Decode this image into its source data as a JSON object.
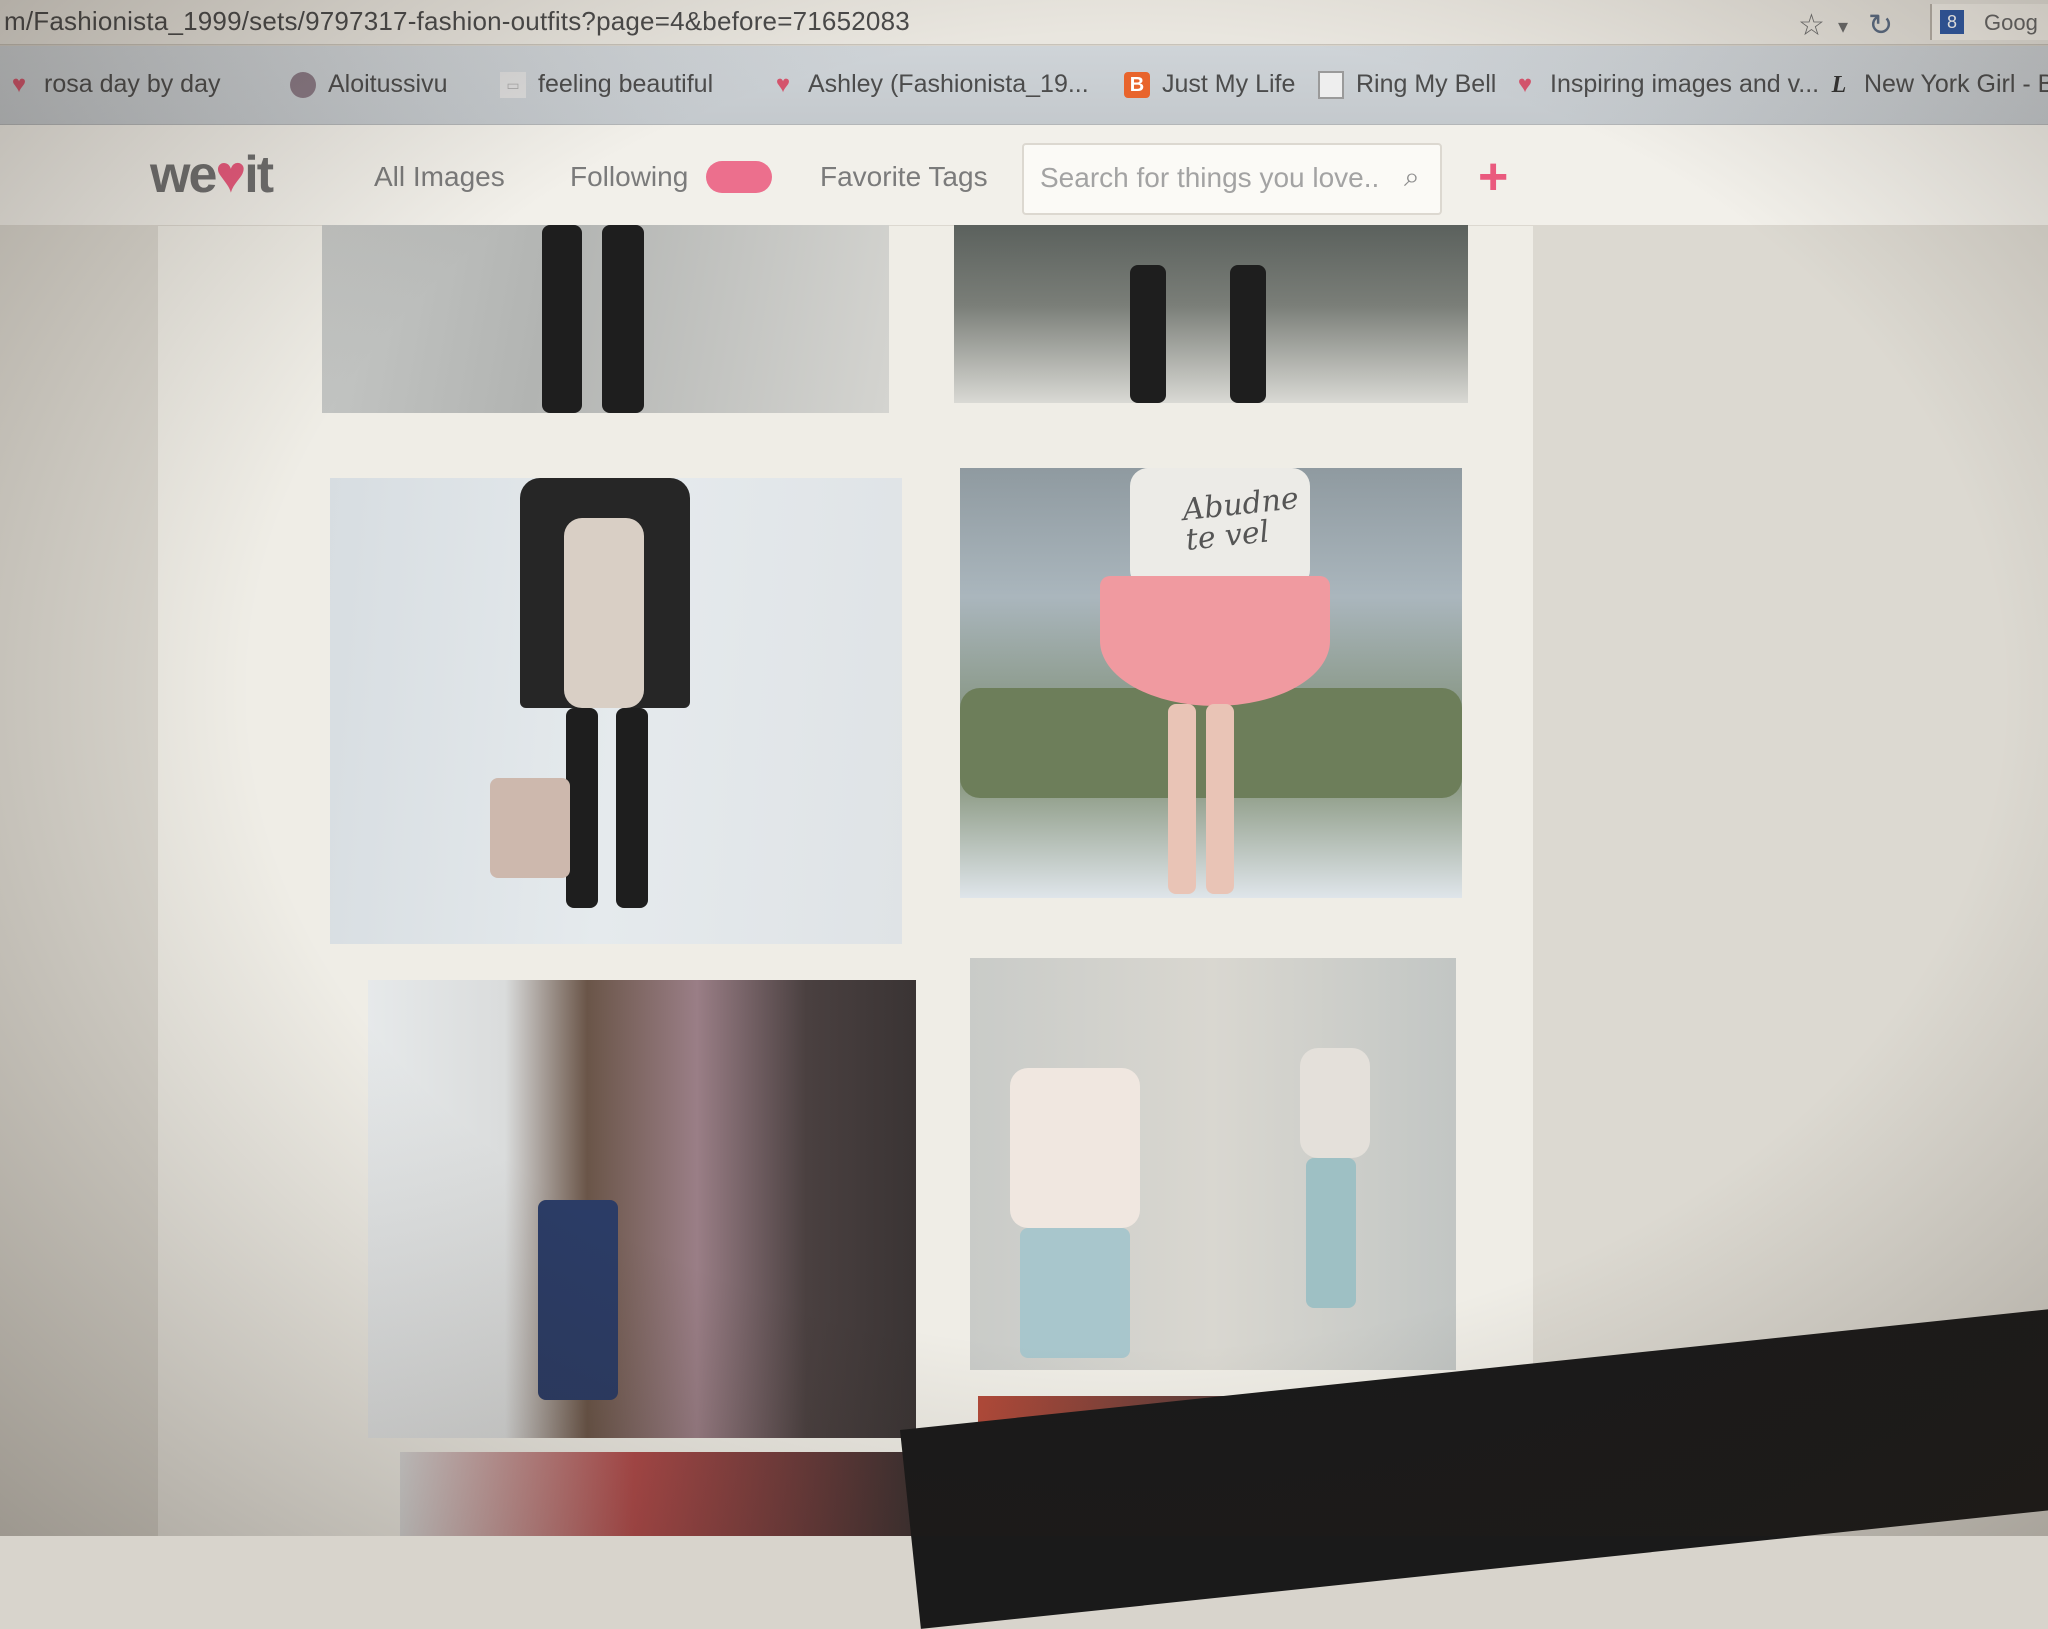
{
  "browser": {
    "url": "m/Fashionista_1999/sets/9797317-fashion-outfits?page=4&before=71652083",
    "search_engine_label": "Goog"
  },
  "bookmarks": [
    {
      "label": "rosa day by day",
      "icon": "heart-icon"
    },
    {
      "label": "Aloitussivu",
      "icon": "avatar-icon"
    },
    {
      "label": "feeling beautiful",
      "icon": "page-icon"
    },
    {
      "label": "Ashley (Fashionista_19...",
      "icon": "heart-icon"
    },
    {
      "label": "Just My Life",
      "icon": "blogger-icon"
    },
    {
      "label": "Ring My Bell",
      "icon": "page-icon"
    },
    {
      "label": "Inspiring images and v...",
      "icon": "heart-icon"
    },
    {
      "label": "New York Girl - Blo",
      "icon": "l-icon"
    }
  ],
  "header": {
    "logo_we": "we",
    "logo_heart": "♥",
    "logo_it": "it",
    "nav": {
      "all_images": "All Images",
      "following": "Following",
      "favorite_tags": "Favorite Tags"
    },
    "search_placeholder": "Search for things you love...",
    "add_label": "+"
  },
  "tiles": {
    "tile4_text": "Abudne\nte vel"
  },
  "colors": {
    "brand_pink": "#ea5a7e",
    "badge_pink": "#ec6f8d"
  }
}
